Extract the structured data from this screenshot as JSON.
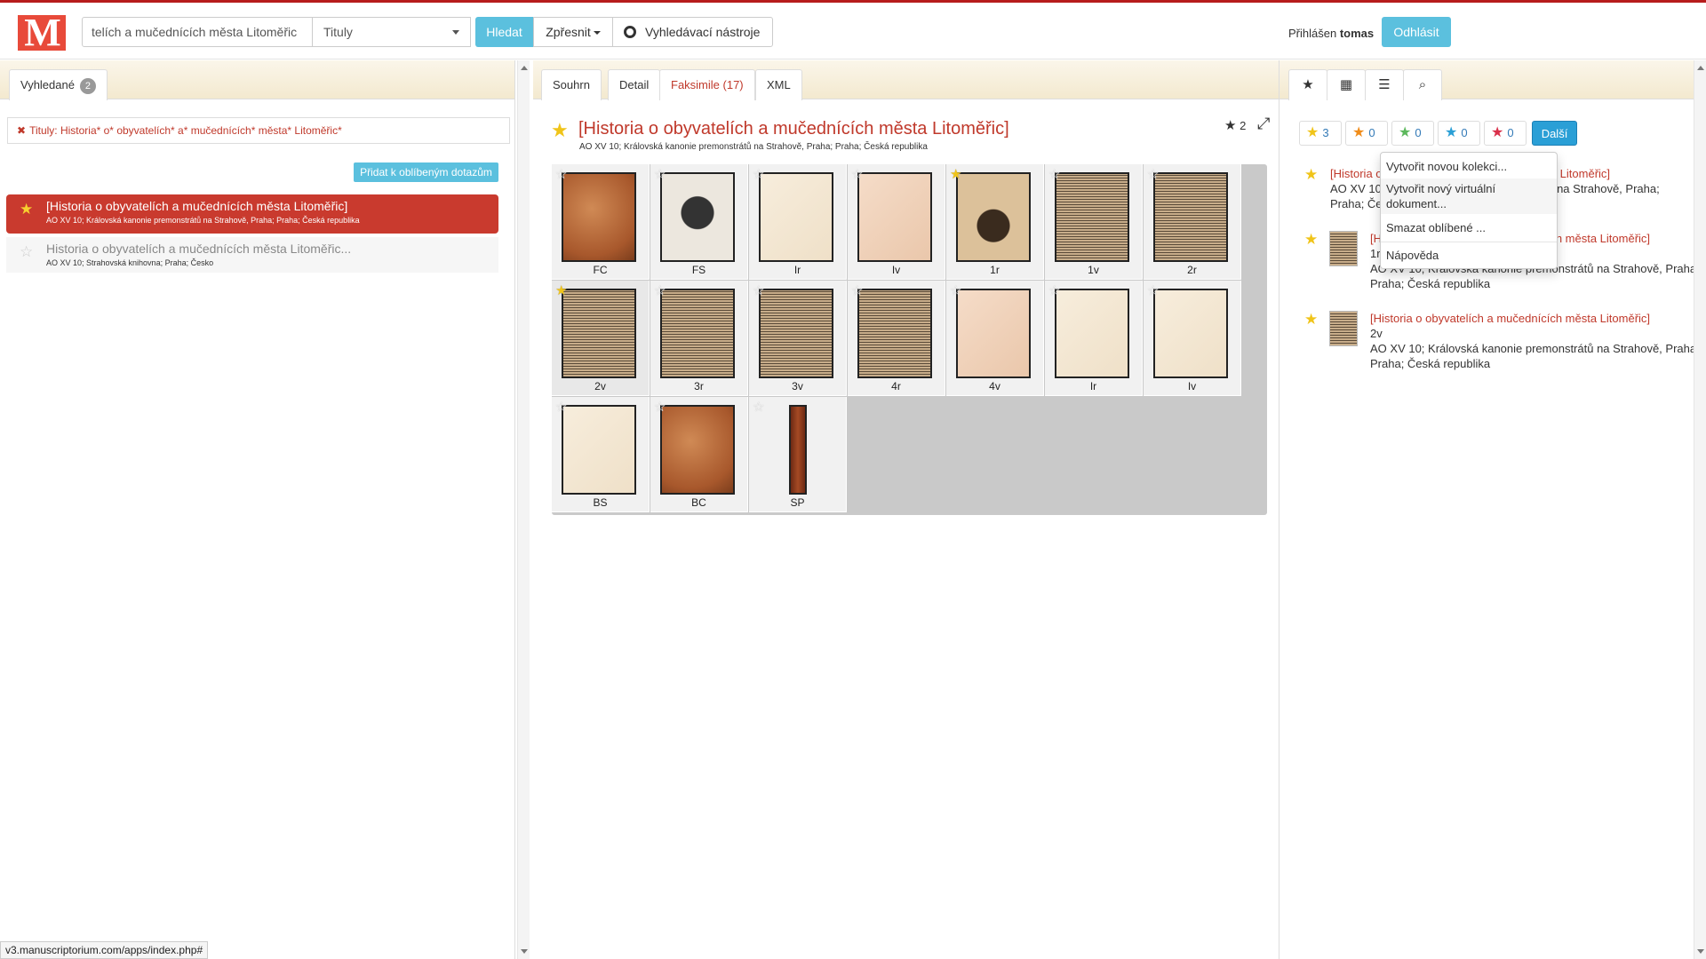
{
  "colors": {
    "accent": "#5bc0de",
    "brand": "#c0392b",
    "highlight": "#c93a2e"
  },
  "header": {
    "logo": "M",
    "search_value": "telích a mučednících města Litoměřic",
    "search_field": "Tituly",
    "search_button": "Hledat",
    "refine_button": "Zpřesnit",
    "tools_button": "Vyhledávací nástroje",
    "logged_prefix": "Přihlášen",
    "logged_user": "tomas",
    "logout_button": "Odhlásit"
  },
  "left": {
    "tab_label": "Vyhledané",
    "tab_count": "2",
    "filter_text": "Tituly: Historia* o* obyvatelích* a* mučednících* města* Litoměřic*",
    "add_fav_button": "Přidat k oblíbeným dotazům",
    "results": [
      {
        "title": "[Historia o obyvatelích a mučednících města Litoměřic]",
        "sub": "AO XV 10; Královská kanonie premonstrátů na Strahově, Praha; Praha; Česká republika"
      },
      {
        "title": "Historia o obyvatelích a mučednících města Litoměřic...",
        "sub": "AO XV 10; Strahovská knihovna; Praha; Česko"
      }
    ]
  },
  "mid": {
    "tabs": [
      "Souhrn",
      "Detail",
      "Faksimile (17)",
      "XML"
    ],
    "doc_title": "[Historia o obyvatelích a mučednících města Litoměřic]",
    "doc_sub": "AO XV 10; Královská kanonie premonstrátů na Strahově, Praha; Praha; Česká republika",
    "fav_count": "2",
    "pages": [
      "FC",
      "FS",
      "Ir",
      "Iv",
      "1r",
      "1v",
      "2r",
      "2v",
      "3r",
      "3v",
      "4r",
      "4v",
      "Ir",
      "Iv",
      "BS",
      "BC",
      "SP"
    ]
  },
  "right": {
    "counters": [
      "3",
      "0",
      "0",
      "0",
      "0"
    ],
    "counter_colors": [
      "#f0c419",
      "#f08c1a",
      "#5cb85c",
      "#2a9fd6",
      "#d9304a"
    ],
    "next_button": "Další",
    "entries": [
      {
        "link": "[Historia o obyvatelích a mučednících města Litoměřic]",
        "page": "",
        "sub": "AO XV 10; Královská kanonie premonstrátů na Strahově, Praha; Praha; Česká republika"
      },
      {
        "link": "[Historia o obyvatelích a mučednících města Litoměřic]",
        "page": "1r",
        "sub": "AO XV 10; Královská kanonie premonstrátů na Strahově, Praha; Praha; Česká republika"
      },
      {
        "link": "[Historia o obyvatelích a mučednících města Litoměřic]",
        "page": "2v",
        "sub": "AO XV 10; Královská kanonie premonstrátů na Strahově, Praha; Praha; Česká republika"
      }
    ],
    "menu": [
      "Vytvořit novou kolekci...",
      "Vytvořit nový virtuální dokument...",
      "Smazat oblíbené ...",
      "Nápověda"
    ]
  },
  "status_url": "v3.manuscriptorium.com/apps/index.php#"
}
